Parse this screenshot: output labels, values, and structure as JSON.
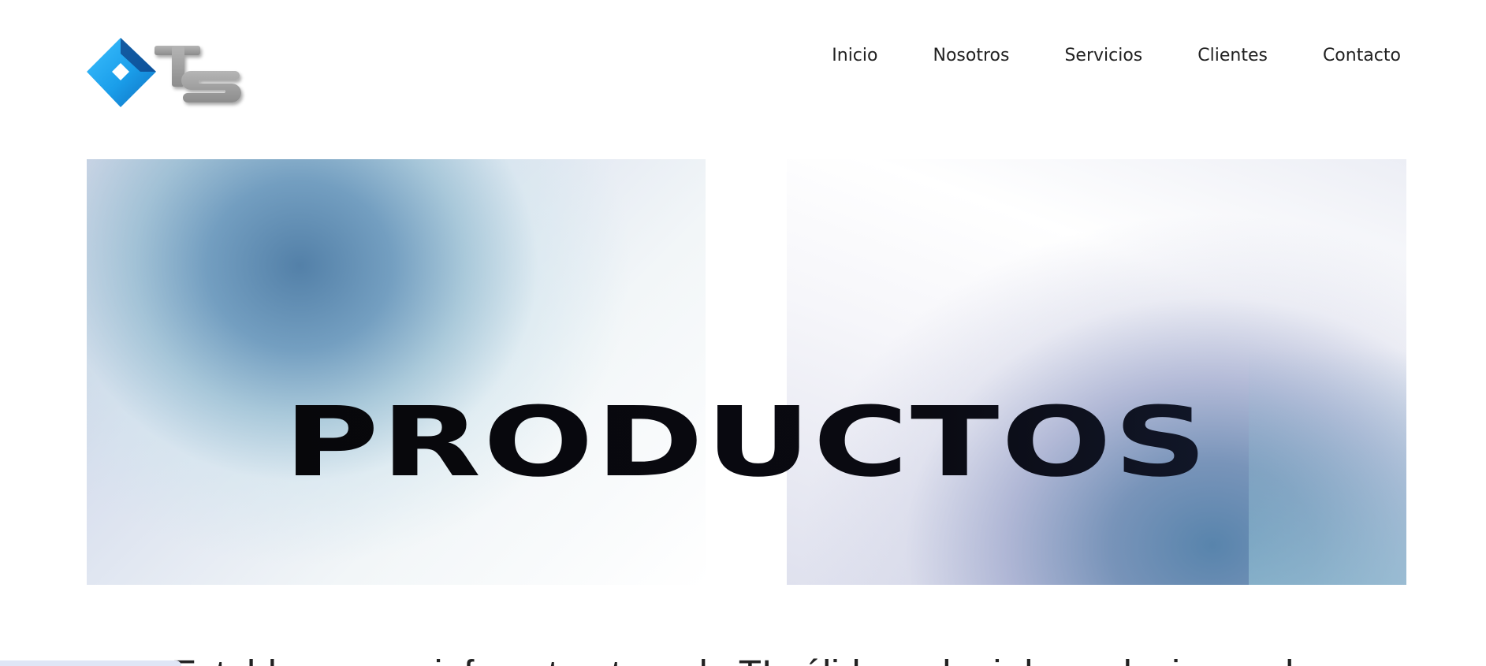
{
  "brand": {
    "logo_text": "TS",
    "colors": {
      "diamond": "#1aa3f0",
      "diamond_dark": "#0b4f9c",
      "letters": "#9a9a9a"
    },
    "icon": "ts-logo-icon"
  },
  "nav": {
    "items": [
      {
        "label": "Inicio"
      },
      {
        "label": "Nosotros"
      },
      {
        "label": "Servicios"
      },
      {
        "label": "Clientes"
      },
      {
        "label": "Contacto"
      }
    ]
  },
  "hero": {
    "title": "PRODUCTOS"
  },
  "intro": {
    "text": "Establecer una infraestructura de TI sólida y elegir las soluciones de"
  }
}
